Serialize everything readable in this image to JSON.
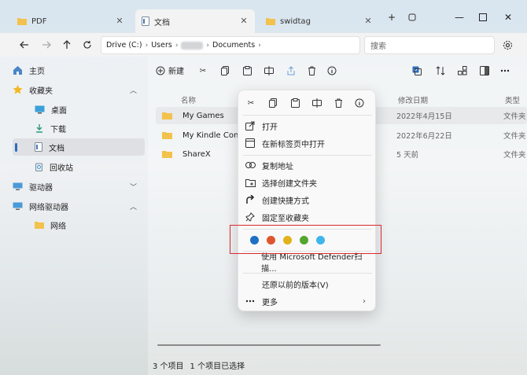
{
  "tabs": [
    {
      "label": "PDF",
      "active": false
    },
    {
      "label": "文档",
      "active": true
    },
    {
      "label": "swidtag",
      "active": false
    }
  ],
  "breadcrumb": [
    "Drive (C:)",
    "Users",
    "Documents"
  ],
  "search": {
    "placeholder": "搜索"
  },
  "sidebar": {
    "items": [
      {
        "label": "主页",
        "icon": "home-icon"
      },
      {
        "label": "收藏夹",
        "icon": "star-icon"
      },
      {
        "label": "桌面",
        "icon": "desktop-icon"
      },
      {
        "label": "下载",
        "icon": "download-icon"
      },
      {
        "label": "文档",
        "icon": "document-icon",
        "selected": true
      },
      {
        "label": "回收站",
        "icon": "recycle-bin-icon"
      },
      {
        "label": "驱动器",
        "icon": "drive-icon"
      },
      {
        "label": "网络驱动器",
        "icon": "network-drive-icon"
      },
      {
        "label": "网络",
        "icon": "folder-icon"
      }
    ]
  },
  "toolbar": {
    "new_label": "新建"
  },
  "columns": {
    "name": "名称",
    "date": "修改日期",
    "type": "类型"
  },
  "files": [
    {
      "name": "My Games",
      "date": "2022年4月15日",
      "type": "文件夹"
    },
    {
      "name": "My Kindle Content",
      "date": "2022年6月22日",
      "type": "文件夹"
    },
    {
      "name": "ShareX",
      "date": "5 天前",
      "type": "文件夹"
    }
  ],
  "status": {
    "count": "3 个项目",
    "selected": "1 个项目已选择"
  },
  "context_menu": {
    "items": [
      {
        "label": "打开",
        "icon": "open-icon"
      },
      {
        "label": "在新标签页中打开",
        "icon": "new-tab-icon"
      },
      {
        "label": "复制地址",
        "icon": "link-icon"
      },
      {
        "label": "选择创建文件夹",
        "icon": "new-folder-icon"
      },
      {
        "label": "创建快捷方式",
        "icon": "shortcut-icon"
      },
      {
        "label": "固定至收藏夹",
        "icon": "pin-icon"
      },
      {
        "label": "使用 Microsoft Defender扫描...",
        "icon": ""
      },
      {
        "label": "还原以前的版本(V)",
        "icon": ""
      },
      {
        "label": "更多",
        "icon": "more-icon"
      }
    ],
    "color_tags": [
      "#1f6fc5",
      "#e0552b",
      "#e3b11b",
      "#55a630",
      "#3fb6ea"
    ]
  }
}
